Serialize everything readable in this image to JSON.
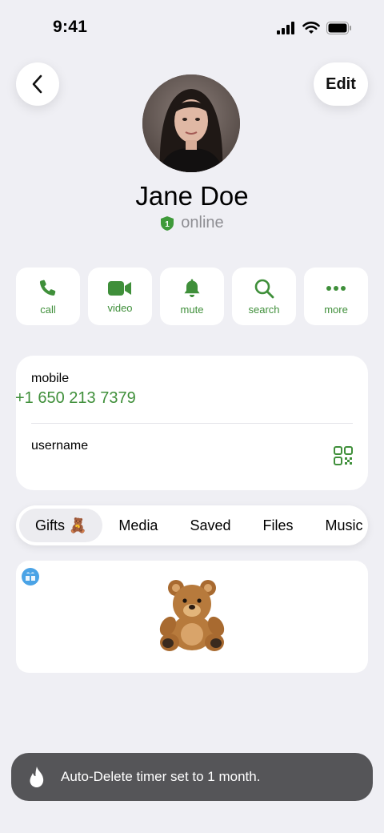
{
  "status_bar": {
    "time": "9:41"
  },
  "header": {
    "edit_label": "Edit"
  },
  "profile": {
    "name": "Jane Doe",
    "status": "online",
    "badge_number": "1"
  },
  "actions": [
    {
      "label": "call",
      "icon": "phone-icon"
    },
    {
      "label": "video",
      "icon": "video-camera-icon"
    },
    {
      "label": "mute",
      "icon": "bell-icon"
    },
    {
      "label": "search",
      "icon": "search-icon"
    },
    {
      "label": "more",
      "icon": "more-dots-icon"
    }
  ],
  "info": {
    "mobile_label": "mobile",
    "mobile_value": "+1 650 213 7379",
    "username_label": "username"
  },
  "tabs": [
    {
      "label": "Gifts 🧸",
      "active": true
    },
    {
      "label": "Media"
    },
    {
      "label": "Saved"
    },
    {
      "label": "Files"
    },
    {
      "label": "Music"
    }
  ],
  "toast": {
    "text": "Auto-Delete timer set to 1 month."
  },
  "colors": {
    "accent": "#3f8f3a",
    "background": "#efeff4",
    "toast": "#555558"
  }
}
